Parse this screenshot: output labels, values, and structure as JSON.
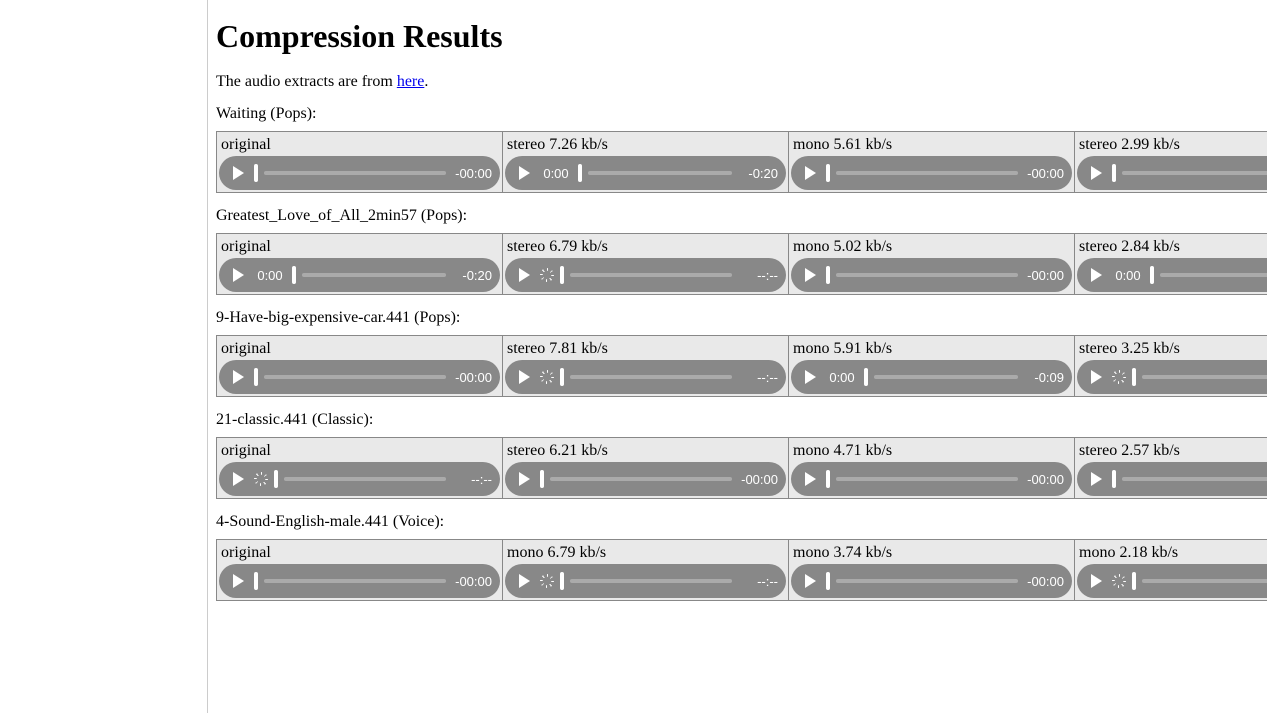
{
  "heading": "Compression Results",
  "intro_prefix": "The audio extracts are from ",
  "intro_link": "here",
  "intro_suffix": ".",
  "tracks": [
    {
      "label": "Waiting (Pops):",
      "cells": [
        {
          "title": "original",
          "cur": "",
          "loading": false,
          "rem": "-00:00"
        },
        {
          "title": "stereo 7.26 kb/s",
          "cur": "0:00",
          "loading": false,
          "rem": "-0:20"
        },
        {
          "title": "mono 5.61 kb/s",
          "cur": "",
          "loading": false,
          "rem": "-00:00"
        },
        {
          "title": "stereo 2.99 kb/s",
          "cur": "",
          "loading": false,
          "rem": ""
        }
      ]
    },
    {
      "label": "Greatest_Love_of_All_2min57 (Pops):",
      "cells": [
        {
          "title": "original",
          "cur": "0:00",
          "loading": false,
          "rem": "-0:20"
        },
        {
          "title": "stereo 6.79 kb/s",
          "cur": "",
          "loading": true,
          "rem": "--:--"
        },
        {
          "title": "mono 5.02 kb/s",
          "cur": "",
          "loading": false,
          "rem": "-00:00"
        },
        {
          "title": "stereo 2.84 kb/s",
          "cur": "0:00",
          "loading": false,
          "rem": ""
        }
      ]
    },
    {
      "label": "9-Have-big-expensive-car.441 (Pops):",
      "cells": [
        {
          "title": "original",
          "cur": "",
          "loading": false,
          "rem": "-00:00"
        },
        {
          "title": "stereo 7.81 kb/s",
          "cur": "",
          "loading": true,
          "rem": "--:--"
        },
        {
          "title": "mono 5.91 kb/s",
          "cur": "0:00",
          "loading": false,
          "rem": "-0:09"
        },
        {
          "title": "stereo 3.25 kb/s",
          "cur": "",
          "loading": true,
          "rem": ""
        }
      ]
    },
    {
      "label": "21-classic.441 (Classic):",
      "cells": [
        {
          "title": "original",
          "cur": "",
          "loading": true,
          "rem": "--:--"
        },
        {
          "title": "stereo 6.21 kb/s",
          "cur": "",
          "loading": false,
          "rem": "-00:00"
        },
        {
          "title": "mono 4.71 kb/s",
          "cur": "",
          "loading": false,
          "rem": "-00:00"
        },
        {
          "title": "stereo 2.57 kb/s",
          "cur": "",
          "loading": false,
          "rem": ""
        }
      ]
    },
    {
      "label": "4-Sound-English-male.441 (Voice):",
      "cells": [
        {
          "title": "original",
          "cur": "",
          "loading": false,
          "rem": "-00:00"
        },
        {
          "title": "mono 6.79 kb/s",
          "cur": "",
          "loading": true,
          "rem": "--:--"
        },
        {
          "title": "mono 3.74 kb/s",
          "cur": "",
          "loading": false,
          "rem": "-00:00"
        },
        {
          "title": "mono 2.18 kb/s",
          "cur": "",
          "loading": true,
          "rem": ""
        }
      ]
    }
  ]
}
